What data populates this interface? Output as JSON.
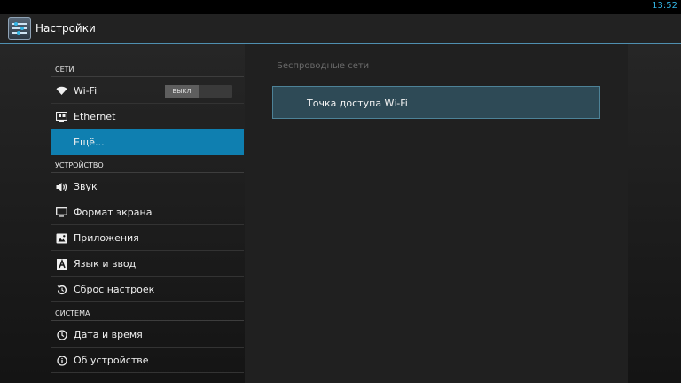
{
  "status_bar": {
    "time": "13:52"
  },
  "action_bar": {
    "title": "Настройки",
    "icon": "settings-app-icon"
  },
  "sidebar": {
    "sections": [
      {
        "label": "СЕТИ"
      },
      {
        "label": "УСТРОЙСТВО"
      },
      {
        "label": "СИСТЕМА"
      }
    ],
    "items": [
      {
        "label": "Wi-Fi",
        "icon": "wifi-icon",
        "toggle": "ВЫКЛ"
      },
      {
        "label": "Ethernet",
        "icon": "ethernet-icon"
      },
      {
        "label": "Ещё...",
        "selected": true
      },
      {
        "label": "Звук",
        "icon": "speaker-icon"
      },
      {
        "label": "Формат экрана",
        "icon": "monitor-icon"
      },
      {
        "label": "Приложения",
        "icon": "apps-icon"
      },
      {
        "label": "Язык и ввод",
        "icon": "keyboard-icon"
      },
      {
        "label": "Сброс настроек",
        "icon": "reset-icon"
      },
      {
        "label": "Дата и время",
        "icon": "clock-icon"
      },
      {
        "label": "Об устройстве",
        "icon": "info-icon"
      }
    ]
  },
  "detail": {
    "header": "Беспроводные сети",
    "items": [
      {
        "label": "Точка доступа Wi-Fi"
      }
    ]
  },
  "colors": {
    "accent": "#33b5e5",
    "selected": "#0f7fb0",
    "hotspot_bg": "#2e4a56",
    "hotspot_border": "#4d8297"
  }
}
